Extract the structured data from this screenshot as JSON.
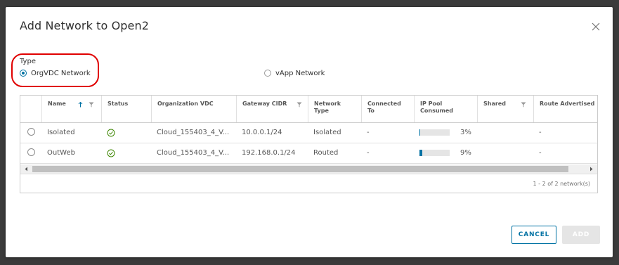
{
  "dialog": {
    "title": "Add Network to Open2",
    "type_label": "Type",
    "options": [
      {
        "label": "OrgVDC Network",
        "selected": true
      },
      {
        "label": "vApp Network",
        "selected": false
      }
    ]
  },
  "grid": {
    "columns": [
      {
        "label": "Name",
        "sortable": true,
        "filterable": true
      },
      {
        "label": "Status"
      },
      {
        "label": "Organization VDC"
      },
      {
        "label": "Gateway CIDR",
        "filterable": true
      },
      {
        "label": "Network Type"
      },
      {
        "label": "Connected To"
      },
      {
        "label": "IP Pool Consumed"
      },
      {
        "label": "Shared",
        "filterable": true
      },
      {
        "label": "Route Advertised"
      }
    ],
    "rows": [
      {
        "name": "Isolated",
        "status": "ok",
        "org_vdc": "Cloud_155403_4_V...",
        "gateway_cidr": "10.0.0.1/24",
        "network_type": "Isolated",
        "connected_to": "-",
        "ip_pool_pct": 3,
        "ip_pool_label": "3%",
        "shared": "",
        "route_advertised": "-"
      },
      {
        "name": "OutWeb",
        "status": "ok",
        "org_vdc": "Cloud_155403_4_V...",
        "gateway_cidr": "192.168.0.1/24",
        "network_type": "Routed",
        "connected_to": "-",
        "ip_pool_pct": 9,
        "ip_pool_label": "9%",
        "shared": "",
        "route_advertised": "-"
      }
    ],
    "footer": "1 - 2 of 2 network(s)"
  },
  "buttons": {
    "cancel": "CANCEL",
    "add": "ADD"
  },
  "colors": {
    "accent": "#0072a3",
    "status_ok": "#3c8500",
    "highlight": "#e00000"
  },
  "icons": {
    "close": "close-icon",
    "sort": "sort-up-icon",
    "filter": "filter-icon",
    "status": "check-circle-icon"
  }
}
